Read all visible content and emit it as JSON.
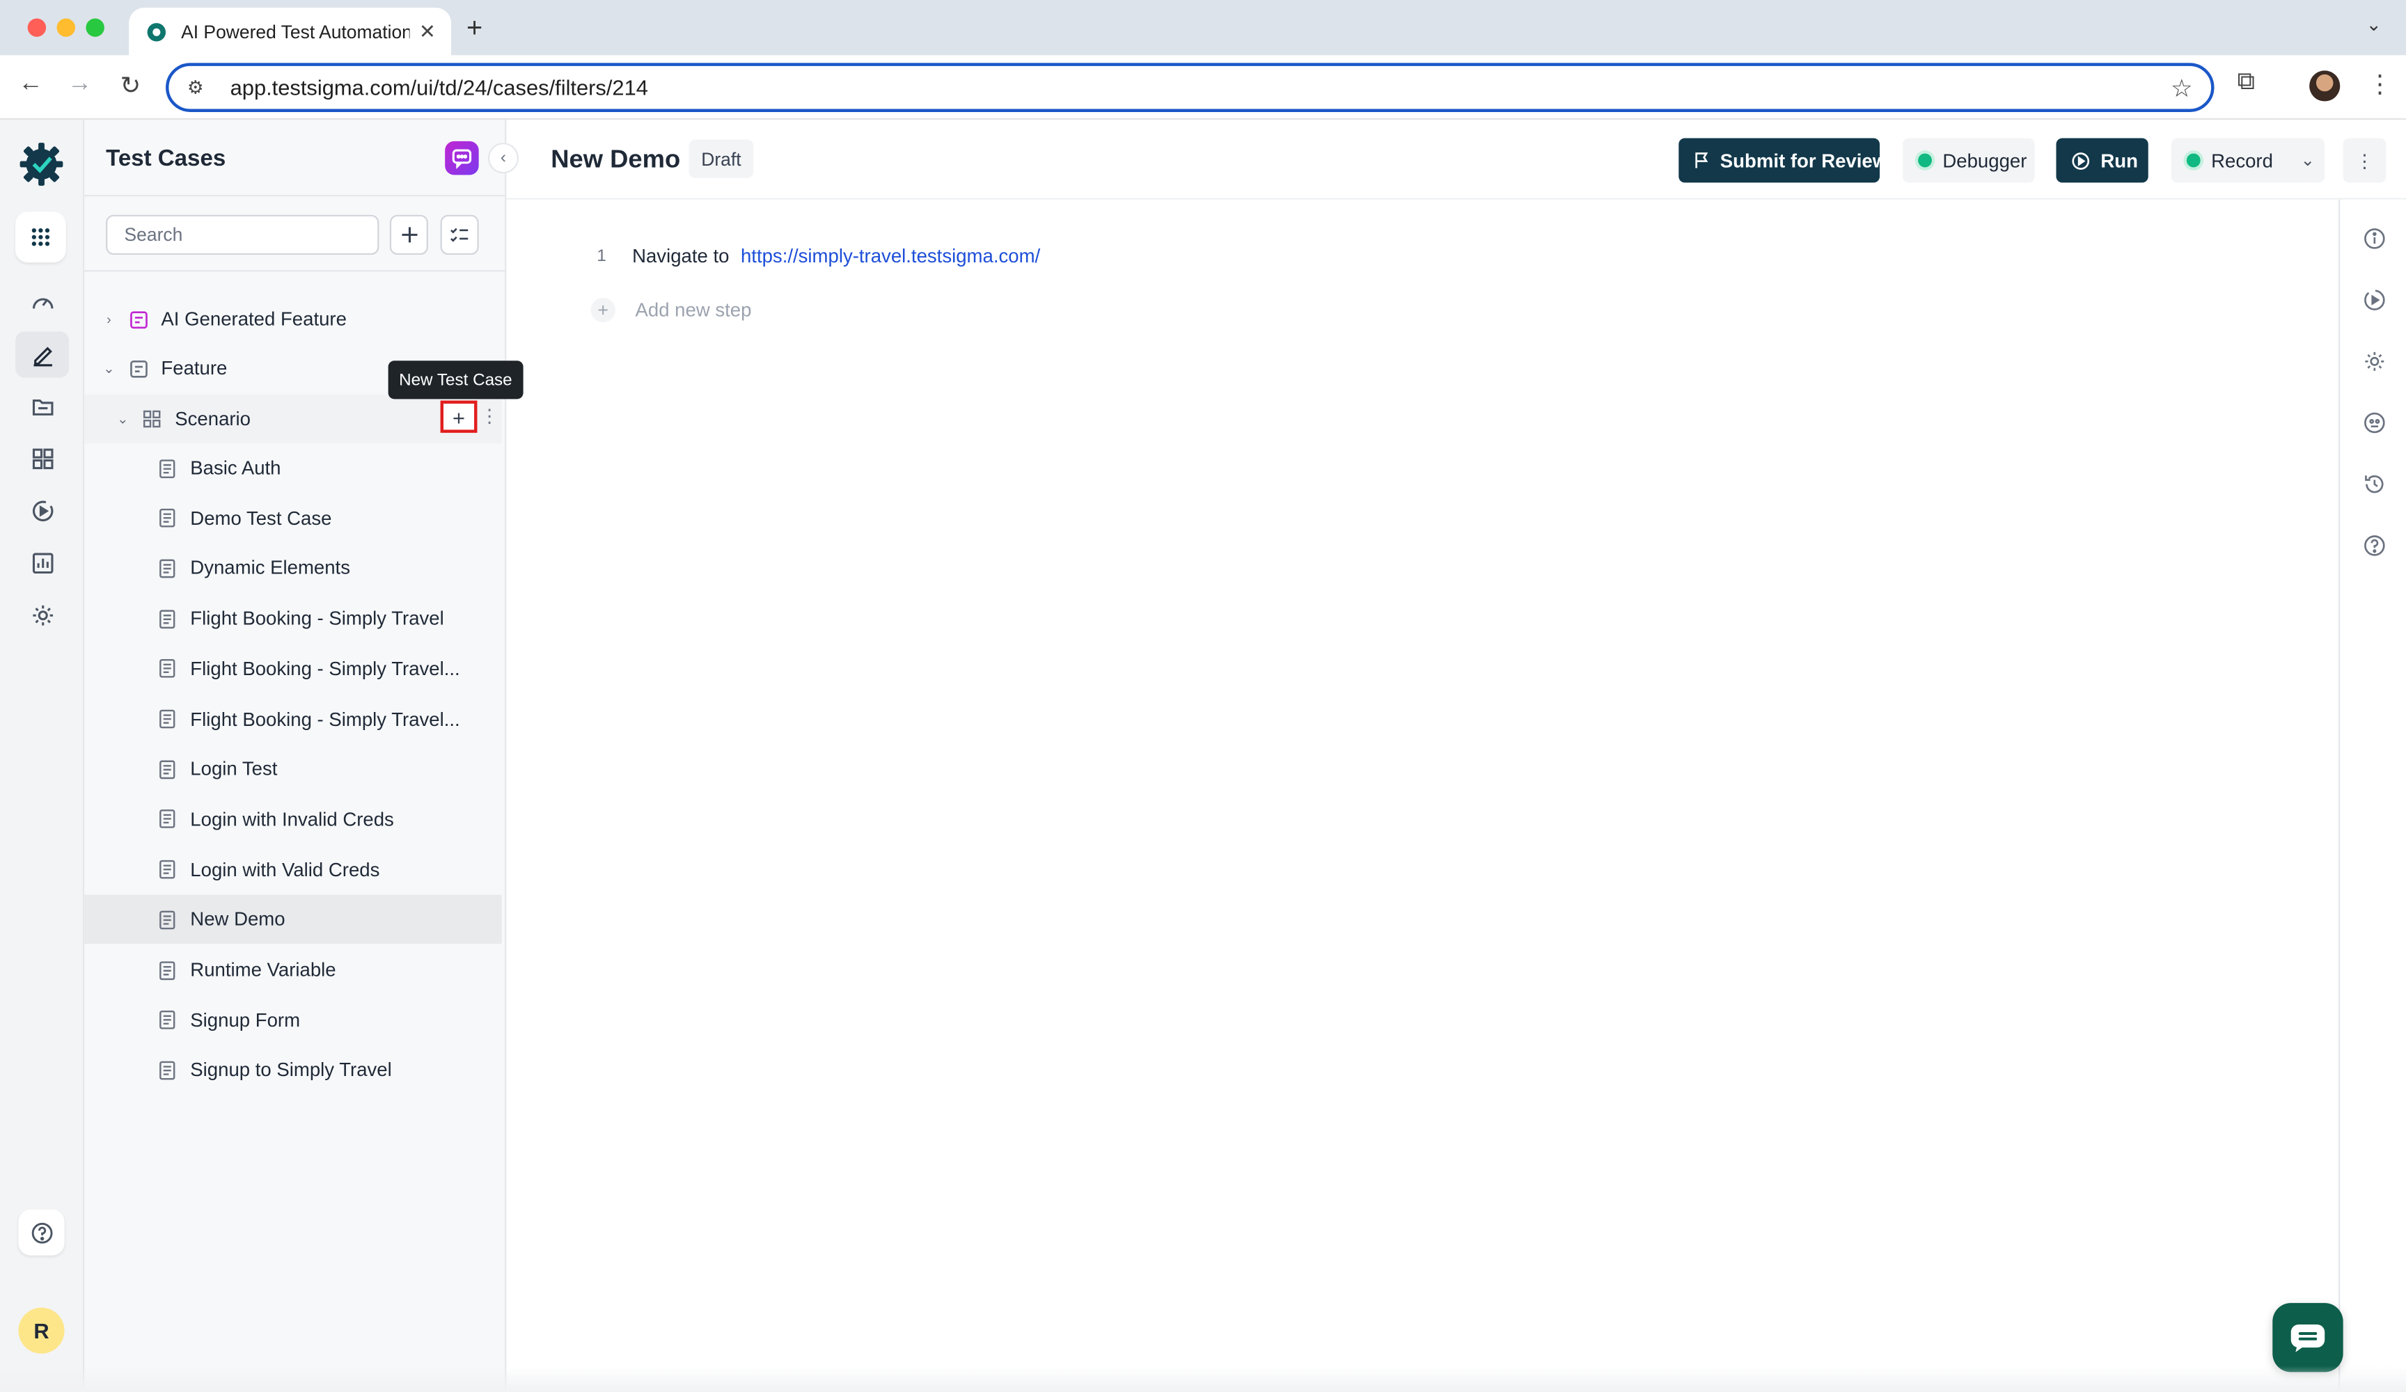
{
  "browser": {
    "tab_title": "AI Powered Test Automation P",
    "url": "app.testsigma.com/ui/td/24/cases/filters/214"
  },
  "panel": {
    "title": "Test Cases",
    "search_placeholder": "Search",
    "tree": {
      "feature_ai": "AI Generated Feature",
      "feature": "Feature",
      "scenario": "Scenario",
      "cases": [
        "Basic Auth",
        "Demo Test Case",
        "Dynamic Elements",
        "Flight Booking - Simply Travel",
        "Flight Booking - Simply Travel...",
        "Flight Booking - Simply Travel...",
        "Login Test",
        "Login with Invalid Creds",
        "Login with Valid Creds",
        "New Demo",
        "Runtime Variable",
        "Signup Form",
        "Signup to Simply Travel"
      ],
      "selected_case": "New Demo"
    },
    "tooltip": "New Test Case"
  },
  "main": {
    "title": "New Demo",
    "status": "Draft",
    "buttons": {
      "submit": "Submit for Review",
      "debugger": "Debugger",
      "run": "Run",
      "record": "Record"
    },
    "steps": [
      {
        "num": "1",
        "action": "Navigate to",
        "value": "https://simply-travel.testsigma.com/"
      }
    ],
    "add_step": "Add new step"
  },
  "user": {
    "avatar_initial": "R"
  },
  "colors": {
    "brand_dark": "#12384a",
    "accent_green": "#10b981",
    "highlight_red": "#e11d1d"
  }
}
